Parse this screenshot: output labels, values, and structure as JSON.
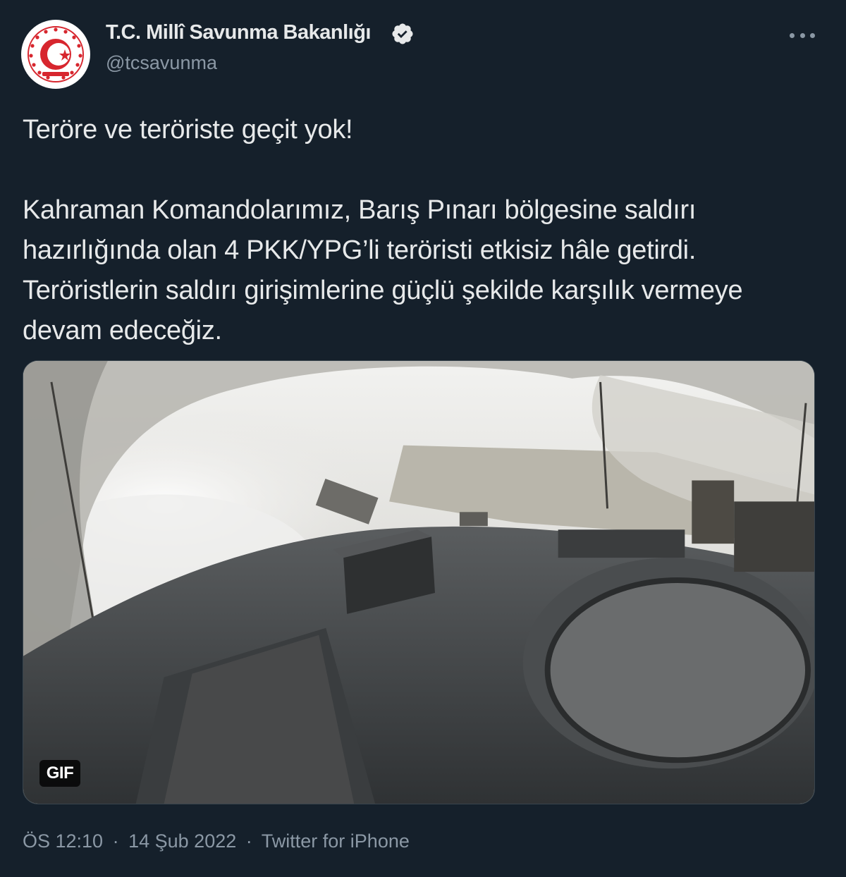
{
  "author": {
    "display_name": "T.C. Millî Savunma Bakanlığı",
    "handle": "@tcsavunma",
    "verified": true,
    "avatar_icon": "ministry-emblem-icon"
  },
  "tweet": {
    "paragraphs": [
      "Teröre ve teröriste geçit yok!",
      "Kahraman Komandolarımız, Barış Pınarı bölgesine saldırı hazırlığında olan 4 PKK/YPG’li teröristi etkisiz hâle getirdi. Teröristlerin saldırı girişimlerine güçlü şekilde karşılık vermeye devam edeceğiz."
    ],
    "media": {
      "badge": "GIF"
    },
    "meta": {
      "time": "ÖS 12:10",
      "separator": "·",
      "date": "14 Şub 2022",
      "source": "Twitter for iPhone"
    }
  },
  "icons": {
    "more": "more-horizontal-icon",
    "verified": "verified-badge-icon"
  },
  "colors": {
    "background": "#15202b",
    "text_primary": "#e7e9ea",
    "text_secondary": "#8b98a5",
    "avatar_red": "#d7262e"
  }
}
